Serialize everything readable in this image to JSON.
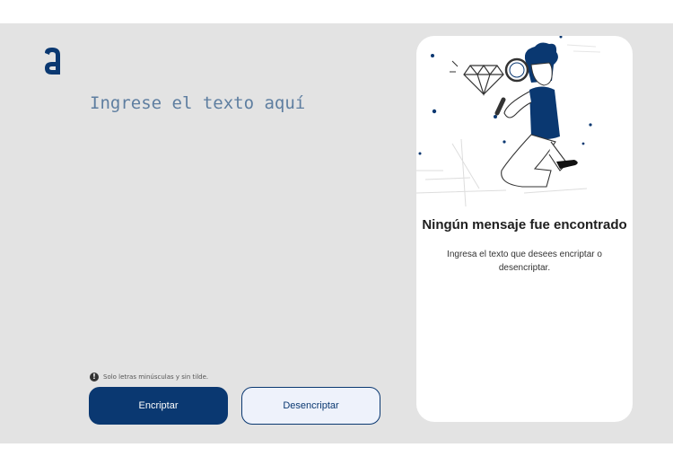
{
  "input": {
    "placeholder": "Ingrese el texto aquí",
    "value": ""
  },
  "hint": {
    "text": "Solo letras minúsculas y sin tilde.",
    "icon": "exclamation-circle-icon"
  },
  "buttons": {
    "encrypt_label": "Encriptar",
    "decrypt_label": "Desencriptar"
  },
  "output": {
    "title": "Ningún mensaje fue encontrado",
    "message": "Ingresa el texto que desees encriptar o desencriptar."
  },
  "colors": {
    "brand": "#0a3871",
    "background": "#e3e3e3",
    "panel": "#ffffff",
    "secondary_button": "#eef2fb"
  }
}
